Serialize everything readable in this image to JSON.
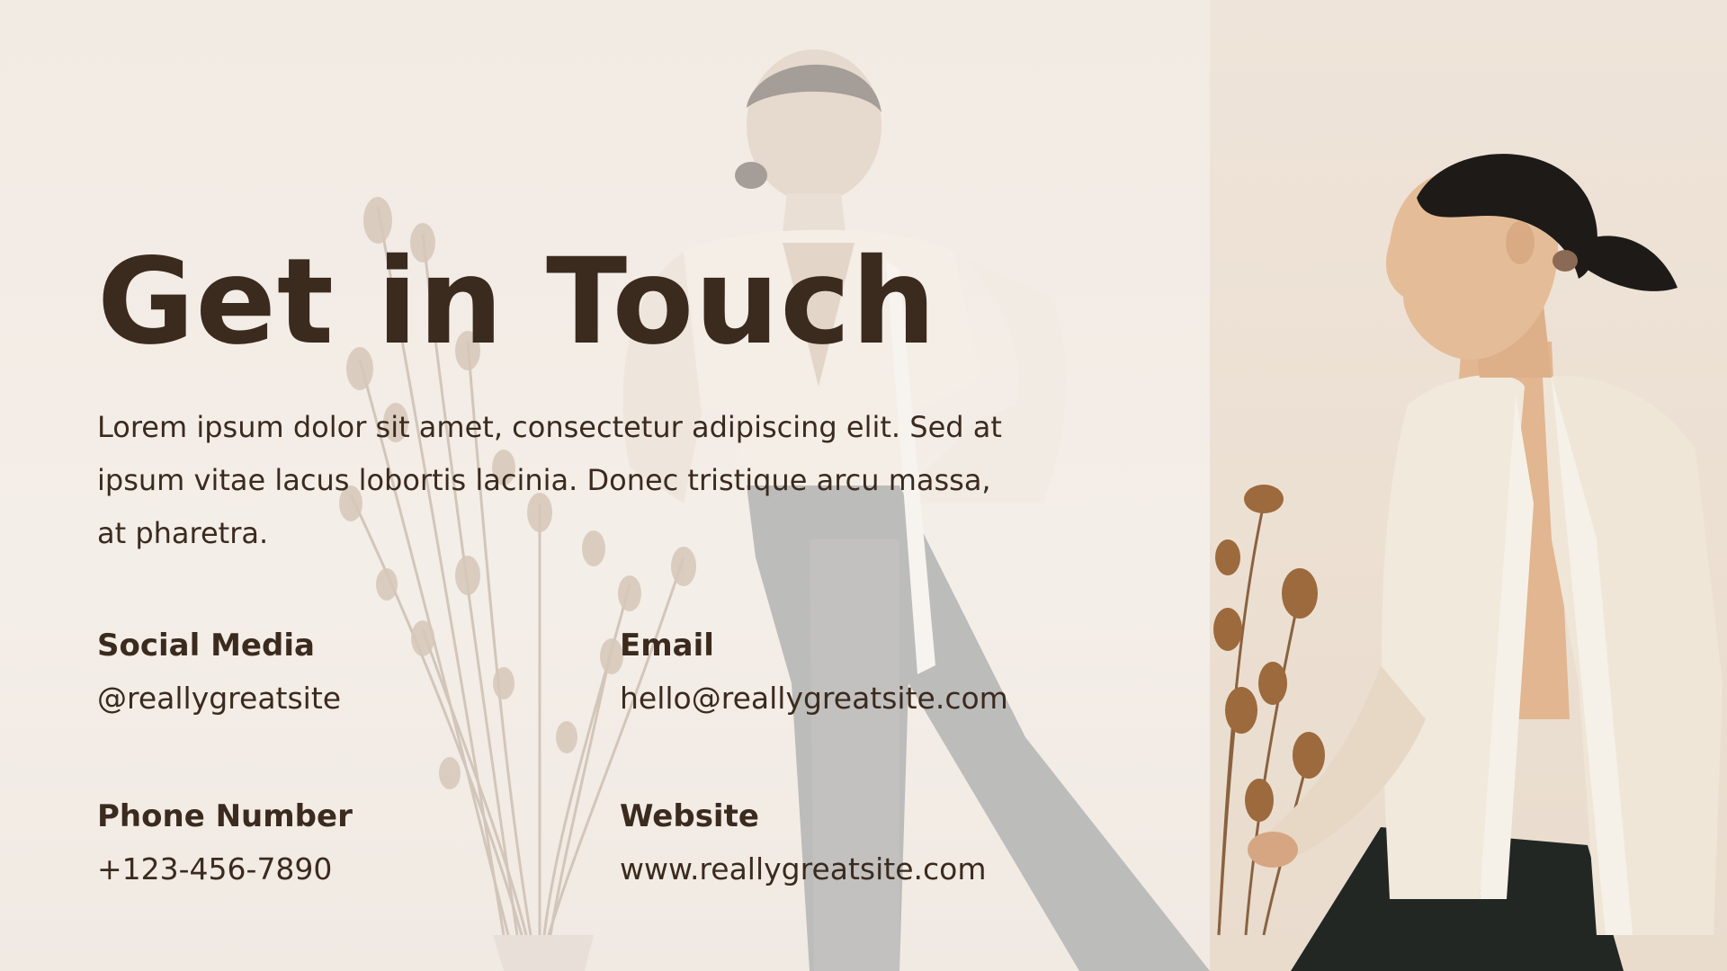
{
  "title": "Get in Touch",
  "body": "Lorem ipsum dolor sit amet, consectetur adipiscing elit. Sed at ipsum vitae lacus lobortis lacinia. Donec tristique arcu massa, at pharetra.",
  "contacts": {
    "social": {
      "label": "Social Media",
      "value": "@reallygreatsite"
    },
    "email": {
      "label": "Email",
      "value": "hello@reallygreatsite.com"
    },
    "phone": {
      "label": "Phone Number",
      "value": "+123-456-7890"
    },
    "website": {
      "label": "Website",
      "value": "www.reallygreatsite.com"
    }
  },
  "colors": {
    "text": "#3b2a1e",
    "background": "#f3ede6",
    "photo_background": "#ece0d3"
  }
}
